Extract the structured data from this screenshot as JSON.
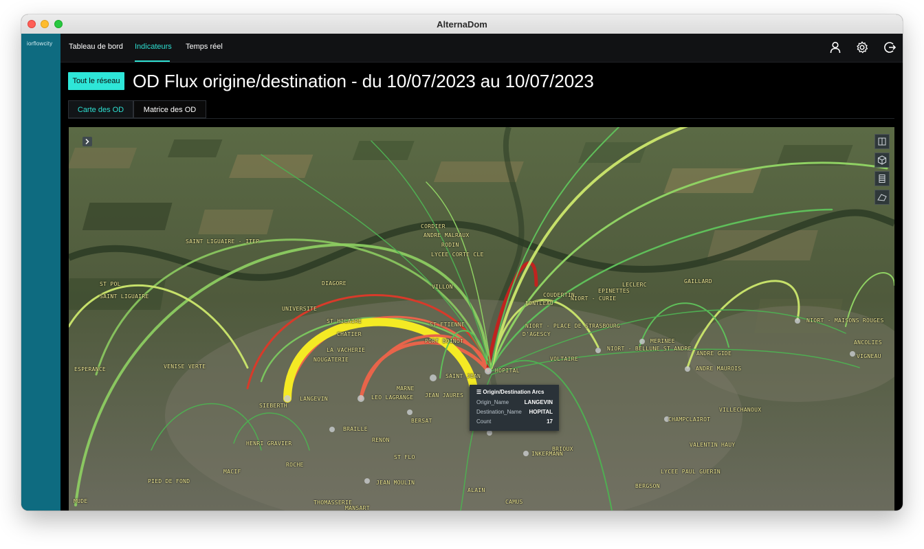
{
  "window": {
    "title": "AlternaDom"
  },
  "brand": {
    "logo_text": "iorflowcity"
  },
  "nav": {
    "items": [
      {
        "label": "Tableau de bord"
      },
      {
        "label": "Indicateurs"
      },
      {
        "label": "Temps réel"
      }
    ],
    "active_index": 1,
    "icons": [
      "user-icon",
      "gear-icon",
      "logout-icon"
    ]
  },
  "header": {
    "scope_button": "Tout le réseau",
    "title": "OD Flux origine/destination - du 10/07/2023 au 10/07/2023"
  },
  "tabs": [
    {
      "label": "Carte des OD"
    },
    {
      "label": "Matrice des OD"
    }
  ],
  "active_tab": 0,
  "map": {
    "tools": [
      "split-view-icon",
      "cube-icon",
      "table-icon",
      "map-style-icon"
    ],
    "labels": [
      "SAINT LIGUAIRE - ITEP",
      "SAINT LIGUAIRE",
      "ST POL",
      "ESPERANCE",
      "VENISE VERTE",
      "UNIVERSITE",
      "DIAGORE",
      "LA VACHERIE",
      "NOUGATERIE",
      "CHATIER",
      "ST HILAIRE",
      "ST ETIENNE",
      "PORT BOINOT",
      "SAINT JEAN",
      "MARNE",
      "JEAN JAURES",
      "LEO LAGRANGE",
      "LANGEVIN",
      "SIEBERTH",
      "BRAILLE",
      "RENON",
      "BERSAT",
      "ST FLO",
      "JEAN MOULIN",
      "ROCHE",
      "HENRI GRAVIER",
      "MACIF",
      "PIED DE FOND",
      "MUDE",
      "THOMASSERIE",
      "MANSART",
      "ALAIN",
      "CAMUS",
      "INKERMANN",
      "BRIOUX",
      "BERGSON",
      "LYCEE PAUL GUERIN",
      "VALENTIN HAUY",
      "CHAMPCLAIROT",
      "VILLECHANOUX",
      "VOLTAIRE",
      "NIORT - PLACE DE STRASBOURG",
      "D'AGESCY",
      "NIORT - BELLUNE ST ANDRE",
      "MERINEE",
      "ANDRE GIDE",
      "ANDRE MAUROIS",
      "NIORT - MAISONS ROUGES",
      "ANCOLIES",
      "VIGNEAU",
      "GAILLARD",
      "LECLERC",
      "EPINETTES",
      "NIORT - CURIE",
      "COUDERTIN",
      "CORDIER",
      "RODIN",
      "LYCEE CORTE CLE",
      "VILLON",
      "FONTLEAU",
      "ANDRE MALRAUX",
      "HOPITAL"
    ]
  },
  "tooltip": {
    "title": "Origin/Destination Arcs",
    "rows": [
      {
        "key": "Origin_Name",
        "value": "LANGEVIN"
      },
      {
        "key": "Destination_Name",
        "value": "HOPITAL"
      },
      {
        "key": "Count",
        "value": "17"
      }
    ]
  },
  "colors": {
    "accent": "#2ee0d2",
    "sidebar": "#0e6b80",
    "arc_high": "#f4ea24",
    "arc_mid": "#e8644a",
    "arc_low": "#5fbf5a",
    "arc_dark_red": "#c0231f"
  }
}
